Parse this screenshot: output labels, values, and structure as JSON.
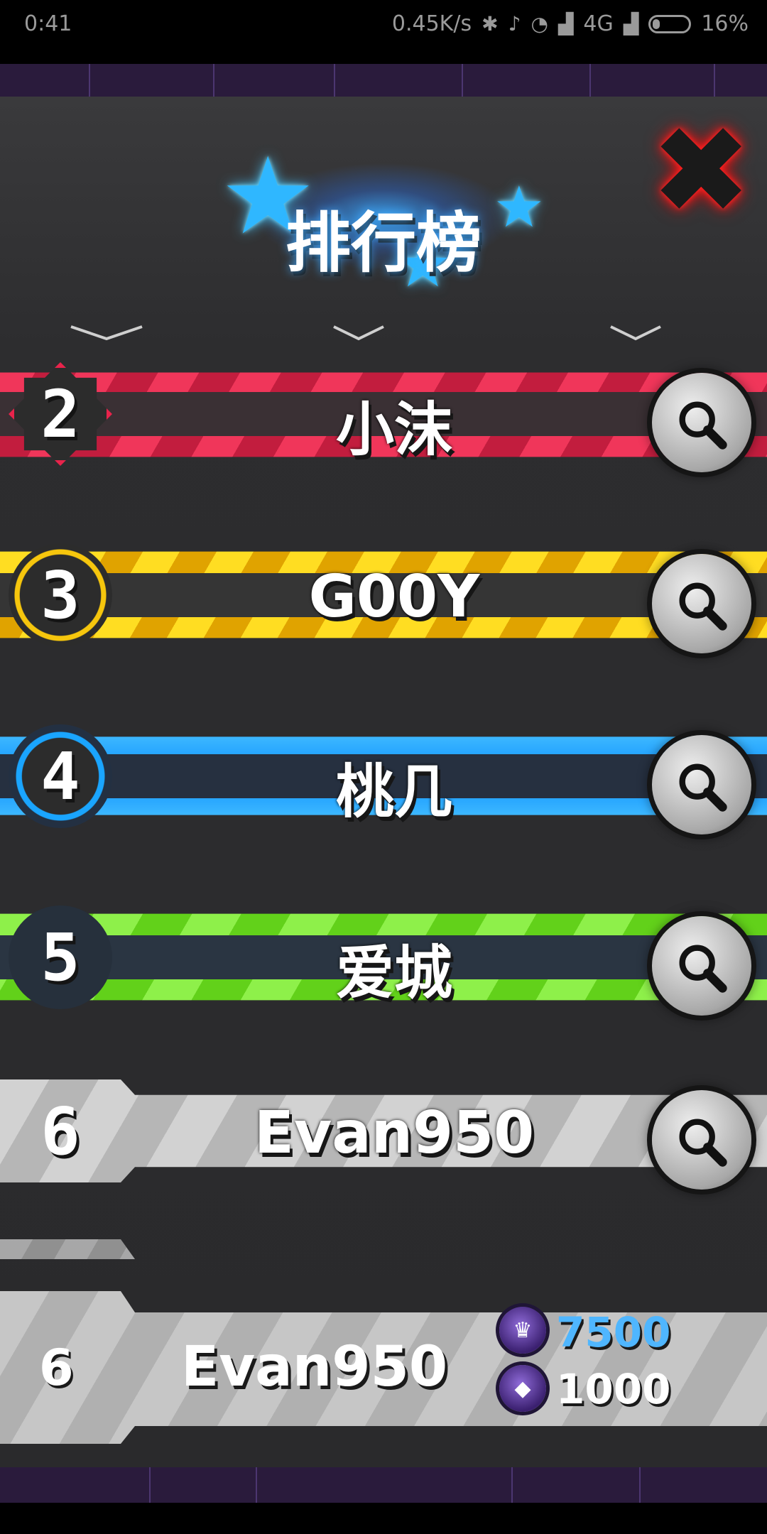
{
  "status_bar": {
    "time": "0:41",
    "net_speed": "0.45K/s",
    "network": "4G",
    "battery_pct": "16%"
  },
  "leaderboard": {
    "title": "排行榜",
    "rows": [
      {
        "rank": "2",
        "name": "小沫",
        "color": "#e8234b"
      },
      {
        "rank": "3",
        "name": "G00Y",
        "color": "#f6c60d"
      },
      {
        "rank": "4",
        "name": "桃几",
        "color": "#1aa5ff"
      },
      {
        "rank": "5",
        "name": "爱城",
        "color": "#6fdd1c"
      },
      {
        "rank": "6",
        "name": "Evan950",
        "color": "#c2c2c2"
      }
    ]
  },
  "my_rank": {
    "rank": "6",
    "name": "Evan950",
    "score_primary": "7500",
    "score_secondary": "1000",
    "primary_color": "#4fb6ff",
    "secondary_color": "#ffffff"
  },
  "icons": {
    "close": "close-icon",
    "search": "magnifier-icon",
    "title_stars": "star-icon"
  }
}
